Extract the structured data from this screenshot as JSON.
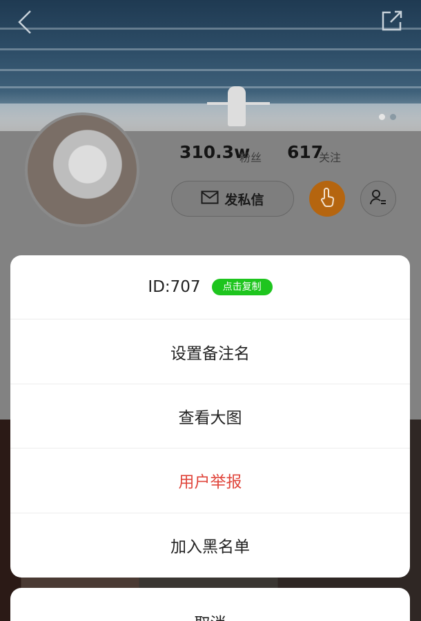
{
  "profile": {
    "fans_count": "310.3w",
    "fans_label": "粉丝",
    "following_count": "617",
    "following_label": "关注",
    "message_button": "发私信"
  },
  "icons": {
    "back": "chevron-left-icon",
    "share": "share-external-icon",
    "message": "envelope-icon",
    "touch": "tap-hand-icon",
    "follow": "add-user-icon"
  },
  "colors": {
    "copy_badge": "#1ec51e",
    "danger_text": "#e0463c",
    "touch_button": "#e88a16"
  },
  "action_sheet": {
    "id_text": "ID:707",
    "copy_label": "点击复制",
    "items": [
      {
        "label": "设置备注名"
      },
      {
        "label": "查看大图"
      },
      {
        "label": "用户举报"
      },
      {
        "label": "加入黑名单"
      }
    ],
    "cancel_label": "取消"
  }
}
